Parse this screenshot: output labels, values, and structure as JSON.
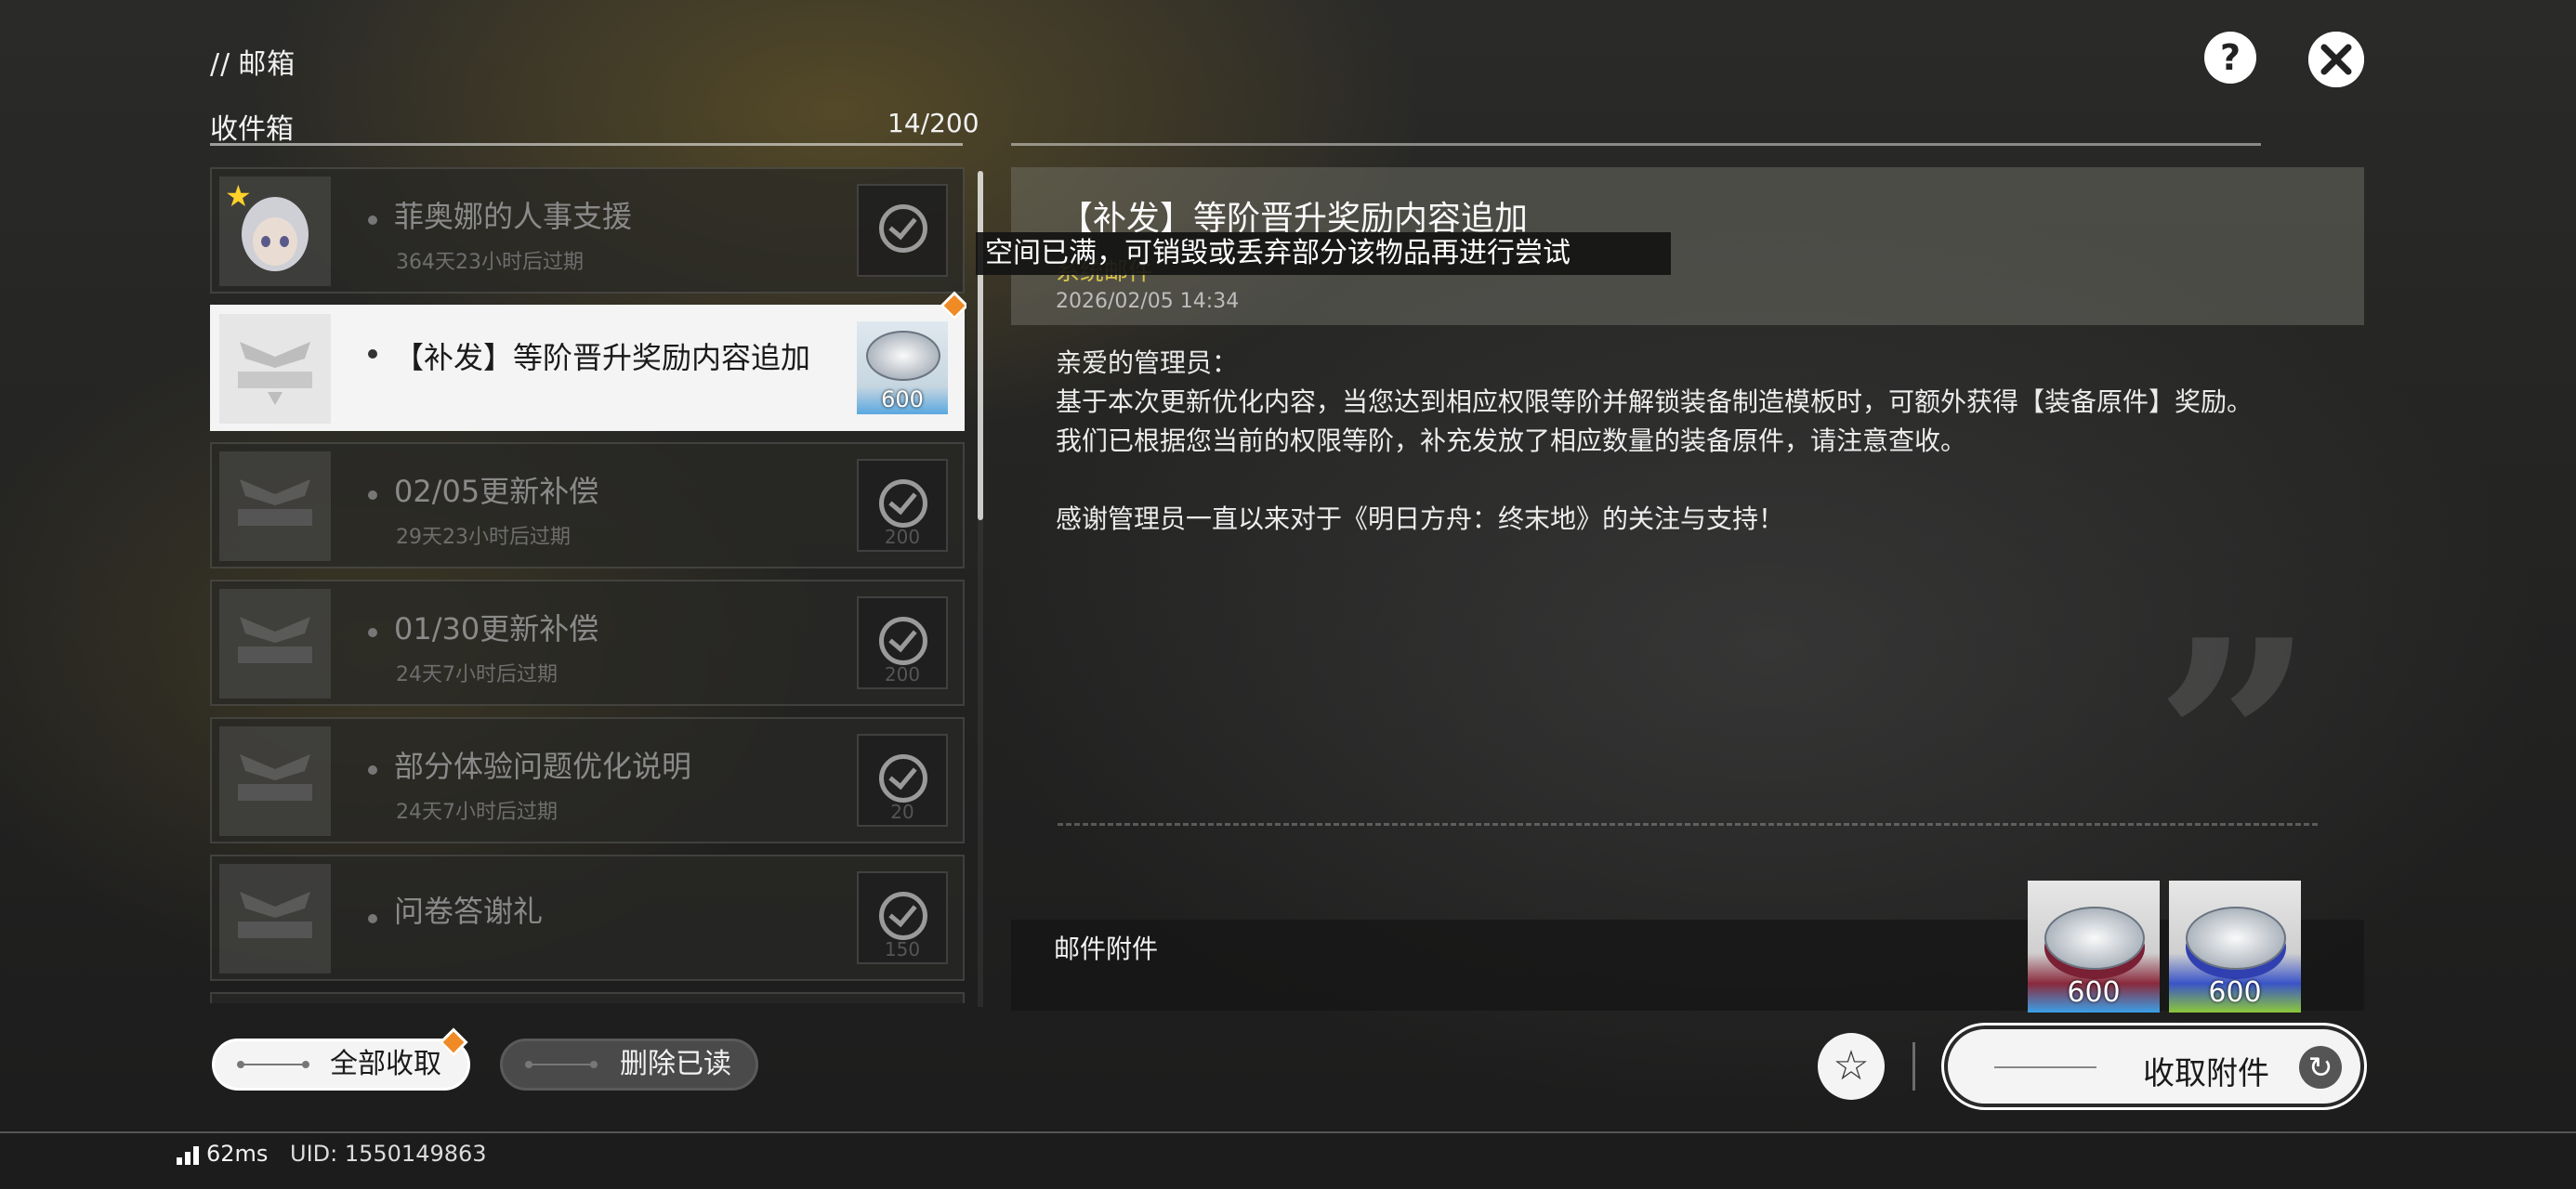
{
  "header": {
    "slashes": "//",
    "title": "邮箱"
  },
  "inbox": {
    "label": "收件箱",
    "count": "14/200"
  },
  "mails": [
    {
      "title": "菲奥娜的人事支援",
      "expiry": "364天23小时后过期",
      "starred": true,
      "claimed": true,
      "reward_qty": ""
    },
    {
      "title": "【补发】等阶晋升奖励内容追加",
      "expiry": "",
      "starred": false,
      "claimed": false,
      "reward_qty": "600",
      "active": true
    },
    {
      "title": "02/05更新补偿",
      "expiry": "29天23小时后过期",
      "starred": false,
      "claimed": true,
      "reward_qty": "200"
    },
    {
      "title": "01/30更新补偿",
      "expiry": "24天7小时后过期",
      "starred": false,
      "claimed": true,
      "reward_qty": "200"
    },
    {
      "title": "部分体验问题优化说明",
      "expiry": "24天7小时后过期",
      "starred": false,
      "claimed": true,
      "reward_qty": "20"
    },
    {
      "title": "问卷答谢礼",
      "expiry": "",
      "starred": false,
      "claimed": true,
      "reward_qty": "150"
    }
  ],
  "buttons": {
    "claim_all": "全部收取",
    "delete_read": "删除已读",
    "collect_attachments": "收取附件"
  },
  "detail": {
    "title": "【补发】等阶晋升奖励内容追加",
    "sender": "系统邮件",
    "date": "2026/02/05 14:34",
    "body": [
      "亲爱的管理员：",
      "基于本次更新优化内容，当您达到相应权限等阶并解锁装备制造模板时，可额外获得【装备原件】奖励。",
      "我们已根据您当前的权限等阶，补充发放了相应数量的装备原件，请注意查收。",
      "",
      "感谢管理员一直以来对于《明日方舟：终末地》的关注与支持！"
    ]
  },
  "toast": {
    "message": "空间已满，可销毁或丢弃部分该物品再进行尝试"
  },
  "attachments": {
    "label": "邮件附件",
    "items": [
      {
        "qty": "600"
      },
      {
        "qty": "600"
      }
    ]
  },
  "footer": {
    "ping": "62ms",
    "uid": "UID: 1550149863"
  },
  "icons": {
    "help": "help-icon",
    "close": "close-icon",
    "favorite": "star-icon",
    "refresh": "refresh-icon",
    "signal": "signal-icon"
  },
  "colors": {
    "accent_new": "#f08a24",
    "sender": "#d8c24a",
    "star": "#ffd22a"
  }
}
